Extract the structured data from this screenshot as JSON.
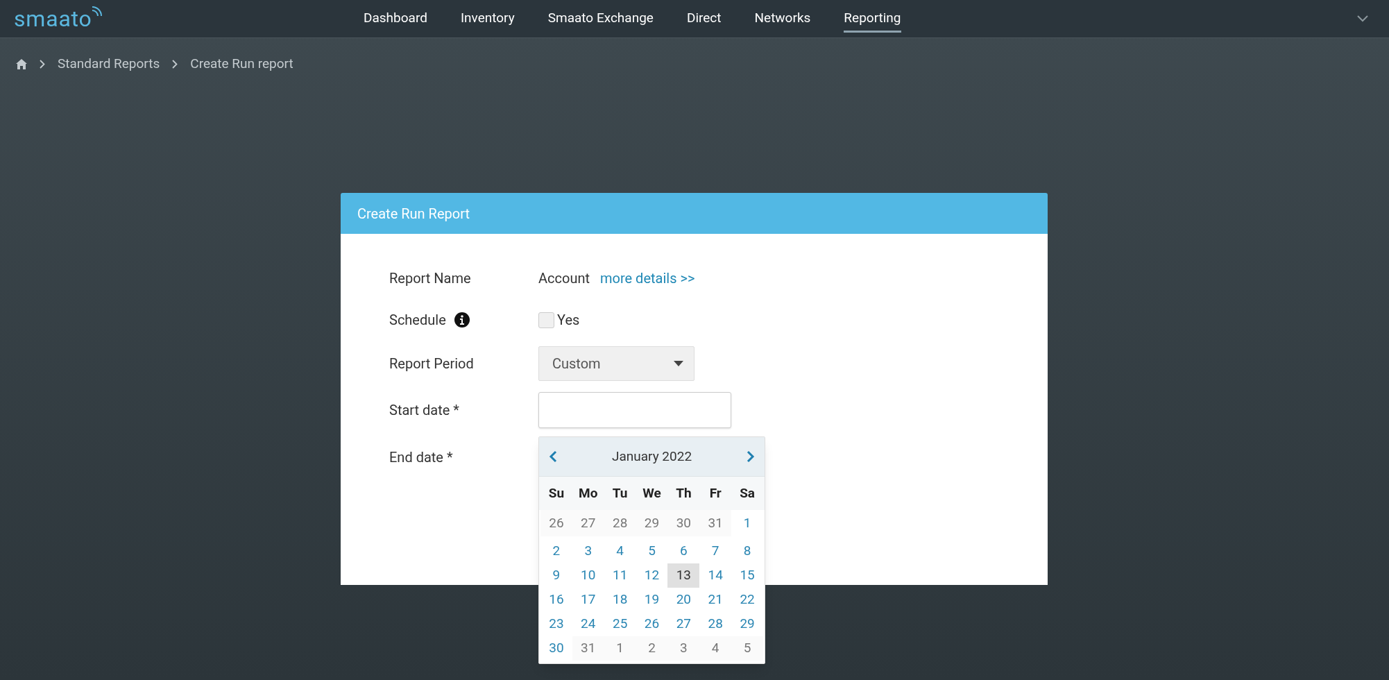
{
  "logo": "smaato",
  "nav": [
    {
      "label": "Dashboard",
      "selected": false
    },
    {
      "label": "Inventory",
      "selected": false
    },
    {
      "label": "Smaato Exchange",
      "selected": false
    },
    {
      "label": "Direct",
      "selected": false
    },
    {
      "label": "Networks",
      "selected": false
    },
    {
      "label": "Reporting",
      "selected": true
    }
  ],
  "breadcrumb": [
    "Standard Reports",
    "Create Run report"
  ],
  "card": {
    "title": "Create Run Report",
    "report_name": {
      "label": "Report Name",
      "value": "Account",
      "link": "more details >>"
    },
    "schedule": {
      "label": "Schedule",
      "checked": false,
      "option": "Yes"
    },
    "report_period": {
      "label": "Report Period",
      "value": "Custom"
    },
    "start_date": {
      "label": "Start date *"
    },
    "end_date": {
      "label": "End date *"
    }
  },
  "calendar": {
    "month": "January 2022",
    "weekdays": [
      "Su",
      "Mo",
      "Tu",
      "We",
      "Th",
      "Fr",
      "Sa"
    ],
    "weeks": [
      [
        {
          "day": "26",
          "outside": true,
          "highlighted": false
        },
        {
          "day": "27",
          "outside": true,
          "highlighted": false
        },
        {
          "day": "28",
          "outside": true,
          "highlighted": false
        },
        {
          "day": "29",
          "outside": true,
          "highlighted": false
        },
        {
          "day": "30",
          "outside": true,
          "highlighted": false
        },
        {
          "day": "31",
          "outside": true,
          "highlighted": false
        },
        {
          "day": "1",
          "outside": false,
          "highlighted": false
        }
      ],
      [
        {
          "day": "2",
          "outside": false,
          "highlighted": false
        },
        {
          "day": "3",
          "outside": false,
          "highlighted": false
        },
        {
          "day": "4",
          "outside": false,
          "highlighted": false
        },
        {
          "day": "5",
          "outside": false,
          "highlighted": false
        },
        {
          "day": "6",
          "outside": false,
          "highlighted": false
        },
        {
          "day": "7",
          "outside": false,
          "highlighted": false
        },
        {
          "day": "8",
          "outside": false,
          "highlighted": false
        }
      ],
      [
        {
          "day": "9",
          "outside": false,
          "highlighted": false
        },
        {
          "day": "10",
          "outside": false,
          "highlighted": false
        },
        {
          "day": "11",
          "outside": false,
          "highlighted": false
        },
        {
          "day": "12",
          "outside": false,
          "highlighted": false
        },
        {
          "day": "13",
          "outside": false,
          "highlighted": true
        },
        {
          "day": "14",
          "outside": false,
          "highlighted": false
        },
        {
          "day": "15",
          "outside": false,
          "highlighted": false
        }
      ],
      [
        {
          "day": "16",
          "outside": false,
          "highlighted": false
        },
        {
          "day": "17",
          "outside": false,
          "highlighted": false
        },
        {
          "day": "18",
          "outside": false,
          "highlighted": false
        },
        {
          "day": "19",
          "outside": false,
          "highlighted": false
        },
        {
          "day": "20",
          "outside": false,
          "highlighted": false
        },
        {
          "day": "21",
          "outside": false,
          "highlighted": false
        },
        {
          "day": "22",
          "outside": false,
          "highlighted": false
        }
      ],
      [
        {
          "day": "23",
          "outside": false,
          "highlighted": false
        },
        {
          "day": "24",
          "outside": false,
          "highlighted": false
        },
        {
          "day": "25",
          "outside": false,
          "highlighted": false
        },
        {
          "day": "26",
          "outside": false,
          "highlighted": false
        },
        {
          "day": "27",
          "outside": false,
          "highlighted": false
        },
        {
          "day": "28",
          "outside": false,
          "highlighted": false
        },
        {
          "day": "29",
          "outside": false,
          "highlighted": false
        }
      ],
      [
        {
          "day": "30",
          "outside": false,
          "highlighted": false
        },
        {
          "day": "31",
          "outside": true,
          "highlighted": false
        },
        {
          "day": "1",
          "outside": true,
          "highlighted": false
        },
        {
          "day": "2",
          "outside": true,
          "highlighted": false
        },
        {
          "day": "3",
          "outside": true,
          "highlighted": false
        },
        {
          "day": "4",
          "outside": true,
          "highlighted": false
        },
        {
          "day": "5",
          "outside": true,
          "highlighted": false
        }
      ]
    ]
  }
}
